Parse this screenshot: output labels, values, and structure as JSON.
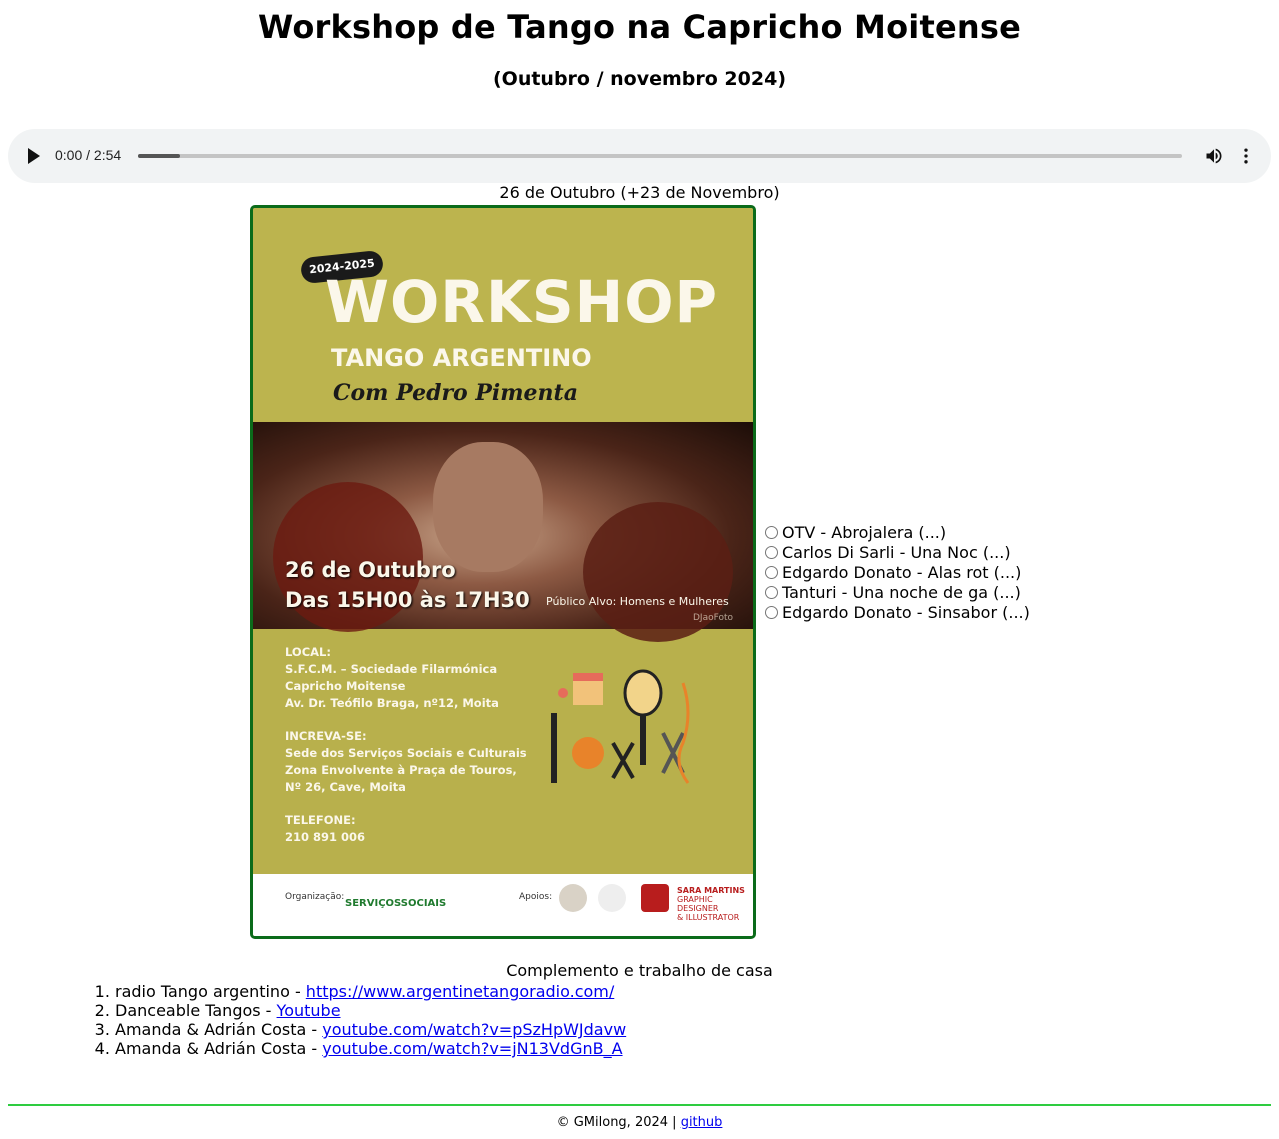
{
  "header": {
    "title": "Workshop de Tango na Capricho Moitense",
    "subtitle": "(Outubro / novembro 2024)"
  },
  "audio": {
    "time_display": "0:00 / 2:54",
    "progress": 0.04,
    "play_icon": "play-icon",
    "volume_icon": "volume-icon",
    "more_icon": "more-options-icon"
  },
  "date_caption": "26 de Outubro (+23 de Novembro)",
  "poster": {
    "badge": "2024-2025",
    "headline": "WORKSHOP",
    "subheadline": "TANGO ARGENTINO",
    "teacher": "Com Pedro Pimenta",
    "date": "26 de Outubro",
    "hours": "Das 15H00 às 17H30",
    "audience": "Público Alvo: Homens e Mulheres",
    "photo_credit": "DJaoFoto",
    "local_label": "LOCAL:",
    "local_lines": [
      "S.F.C.M. – Sociedade Filarmónica",
      "Capricho Moitense",
      "Av. Dr. Teófilo Braga, nº12, Moita"
    ],
    "inscreva_label": "INCREVA-SE:",
    "inscreva_lines": [
      "Sede dos Serviços Sociais e Culturais",
      "Zona Envolvente à Praça de Touros,",
      "Nº 26, Cave, Moita"
    ],
    "telefone_label": "TELEFONE:",
    "telefone": "210 891 006",
    "org_label": "Organização:",
    "org_logo_text": "SERVIÇOSSOCIAIS",
    "apoios_label": "Apoios:",
    "sara_line1": "SARA MARTINS",
    "sara_line2": "GRAPHIC DESIGNER",
    "sara_line3": "& ILLUSTRATOR"
  },
  "tracks": [
    {
      "label": "OTV - Abrojalera (...)"
    },
    {
      "label": "Carlos Di Sarli - Una Noc (...)"
    },
    {
      "label": "Edgardo Donato - Alas rot (...)"
    },
    {
      "label": "Tanturi - Una noche de ga (...)"
    },
    {
      "label": "Edgardo Donato - Sinsabor (...)"
    }
  ],
  "complement": {
    "title": "Complemento e trabalho de casa",
    "items": [
      {
        "prefix": "radio Tango argentino - ",
        "link": "https://www.argentinetangoradio.com/"
      },
      {
        "prefix": "Danceable Tangos - ",
        "link": "Youtube"
      },
      {
        "prefix": "Amanda & Adrián Costa - ",
        "link": "youtube.com/watch?v=pSzHpWJdavw"
      },
      {
        "prefix": "Amanda & Adrián Costa - ",
        "link": "youtube.com/watch?v=jN13VdGnB_A"
      }
    ]
  },
  "footer": {
    "text": "© GMilong, 2024 | ",
    "link": "github"
  },
  "colors": {
    "poster_bg": "#bcb44e",
    "poster_border": "#0b6b1a",
    "footer_rule": "#2ecc40",
    "link": "#0000ee"
  }
}
